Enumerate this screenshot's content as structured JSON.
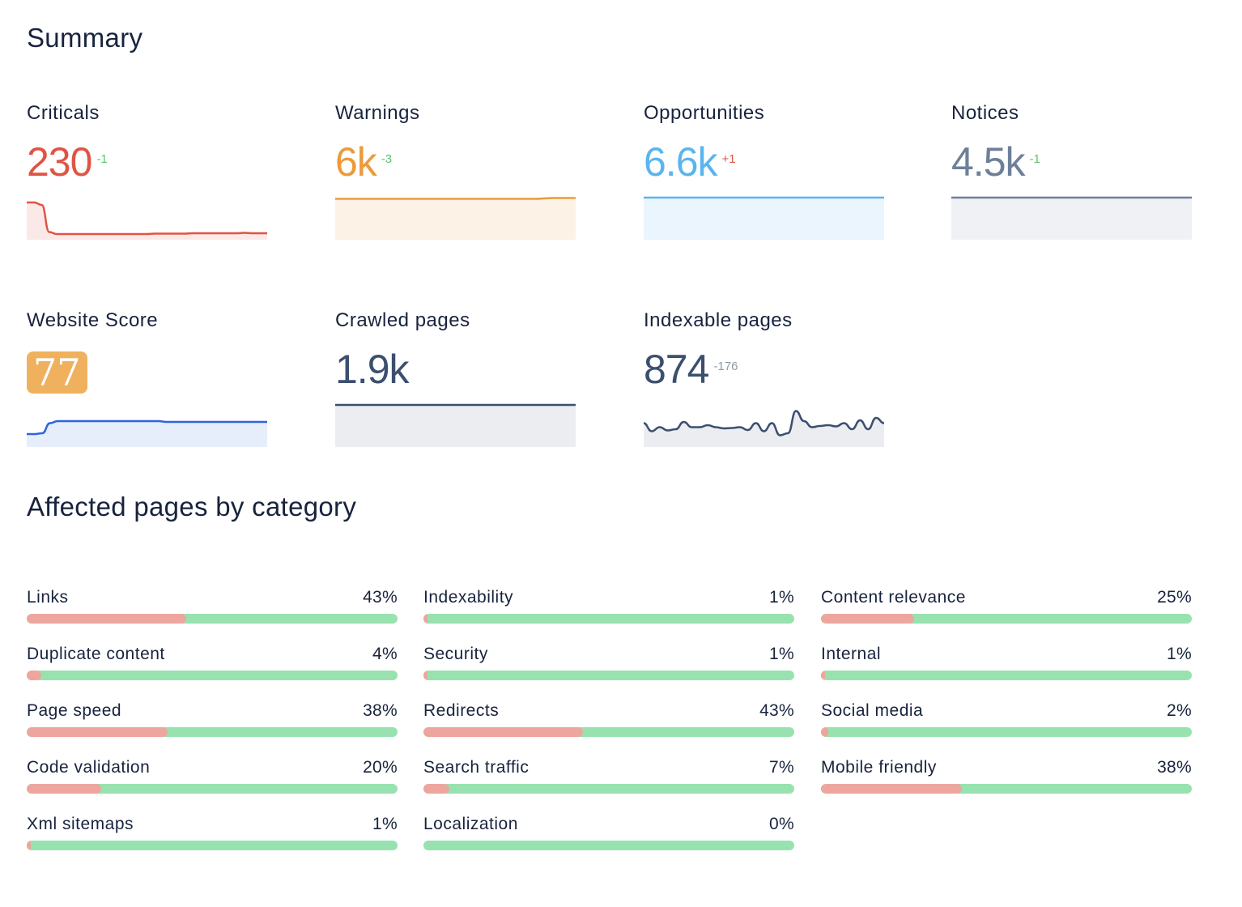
{
  "summary": {
    "title": "Summary",
    "metrics": [
      {
        "label": "Criticals",
        "value": "230",
        "delta": "-1",
        "color": "#e05444",
        "delta_color": "#5cc56e",
        "fill": "#fbe9e7",
        "series": [
          0.88,
          0.88,
          0.82,
          0.15,
          0.1,
          0.1,
          0.1,
          0.1,
          0.1,
          0.1,
          0.1,
          0.1,
          0.1,
          0.1,
          0.1,
          0.1,
          0.1,
          0.11,
          0.11,
          0.11,
          0.11,
          0.11,
          0.12,
          0.12,
          0.12,
          0.12,
          0.12,
          0.12,
          0.12,
          0.13,
          0.12,
          0.12,
          0.12
        ]
      },
      {
        "label": "Warnings",
        "value": "6k",
        "delta": "-3",
        "color": "#ed9a3a",
        "delta_color": "#5cc56e",
        "fill": "#fdf2e6",
        "series": [
          0.97,
          0.97,
          0.97,
          0.97,
          0.97,
          0.97,
          0.97,
          0.97,
          0.97,
          0.97,
          0.97,
          0.97,
          0.97,
          0.97,
          0.97,
          0.97,
          0.97,
          0.97,
          0.97,
          0.97,
          0.97,
          0.97,
          0.97,
          0.97,
          0.97,
          0.97,
          0.97,
          0.98,
          0.99,
          0.99,
          0.99,
          0.99
        ]
      },
      {
        "label": "Opportunities",
        "value": "6.6k",
        "delta": "+1",
        "color": "#5ab5ef",
        "delta_color": "#e05444",
        "fill": "#ebf5fd",
        "series": [
          1,
          1,
          1,
          1,
          1,
          1,
          1,
          1,
          1,
          1,
          1,
          1,
          1,
          1,
          1,
          1,
          1,
          1,
          1,
          1
        ]
      },
      {
        "label": "Notices",
        "value": "4.5k",
        "delta": "-1",
        "color": "#6e7f99",
        "delta_color": "#5cc56e",
        "fill": "#eff1f5",
        "series": [
          1,
          1,
          1,
          1,
          1,
          1,
          1,
          1,
          1,
          1,
          1,
          1,
          1,
          1,
          1,
          1,
          1,
          1,
          1,
          1
        ]
      },
      {
        "label": "Website Score",
        "value": "77",
        "delta": "",
        "is_badge": true,
        "badge_color": "#f0b15e",
        "color": "#2f64e0",
        "fill": "#e6edfb",
        "series": [
          0.28,
          0.28,
          0.3,
          0.55,
          0.6,
          0.6,
          0.6,
          0.6,
          0.6,
          0.6,
          0.6,
          0.6,
          0.6,
          0.6,
          0.6,
          0.6,
          0.6,
          0.6,
          0.58,
          0.58,
          0.58,
          0.58,
          0.58,
          0.58,
          0.58,
          0.58,
          0.58,
          0.58,
          0.58,
          0.58,
          0.58,
          0.58
        ]
      },
      {
        "label": "Crawled pages",
        "value": "1.9k",
        "delta": "",
        "color": "#3b4f6e",
        "fill": "#ebedf1",
        "series": [
          1,
          1,
          1,
          1,
          1,
          1,
          1,
          1,
          1,
          1,
          1,
          1,
          1,
          1,
          1,
          1,
          1,
          1,
          1,
          1
        ]
      },
      {
        "label": "Indexable pages",
        "value": "874",
        "delta": "-176",
        "color": "#3b4f6e",
        "delta_color": "#8e99a9",
        "fill": "#ebedf1",
        "series": [
          0.55,
          0.35,
          0.45,
          0.37,
          0.4,
          0.58,
          0.45,
          0.45,
          0.5,
          0.45,
          0.42,
          0.43,
          0.45,
          0.38,
          0.55,
          0.35,
          0.55,
          0.25,
          0.3,
          0.85,
          0.6,
          0.45,
          0.48,
          0.5,
          0.47,
          0.55,
          0.4,
          0.62,
          0.4,
          0.68,
          0.55
        ]
      }
    ]
  },
  "affected": {
    "title": "Affected pages by category",
    "categories": [
      {
        "label": "Links",
        "percent": 43,
        "percent_label": "43%"
      },
      {
        "label": "Duplicate content",
        "percent": 4,
        "percent_label": "4%"
      },
      {
        "label": "Page speed",
        "percent": 38,
        "percent_label": "38%"
      },
      {
        "label": "Code validation",
        "percent": 20,
        "percent_label": "20%"
      },
      {
        "label": "Xml sitemaps",
        "percent": 1,
        "percent_label": "1%"
      },
      {
        "label": "Indexability",
        "percent": 1,
        "percent_label": "1%"
      },
      {
        "label": "Security",
        "percent": 1,
        "percent_label": "1%"
      },
      {
        "label": "Redirects",
        "percent": 43,
        "percent_label": "43%"
      },
      {
        "label": "Search traffic",
        "percent": 7,
        "percent_label": "7%"
      },
      {
        "label": "Localization",
        "percent": 0,
        "percent_label": "0%"
      },
      {
        "label": "Content relevance",
        "percent": 25,
        "percent_label": "25%"
      },
      {
        "label": "Internal",
        "percent": 1,
        "percent_label": "1%"
      },
      {
        "label": "Social media",
        "percent": 2,
        "percent_label": "2%"
      },
      {
        "label": "Mobile friendly",
        "percent": 38,
        "percent_label": "38%"
      }
    ],
    "colors": {
      "affected": "#eda69e",
      "healthy": "#98e2b0"
    }
  }
}
